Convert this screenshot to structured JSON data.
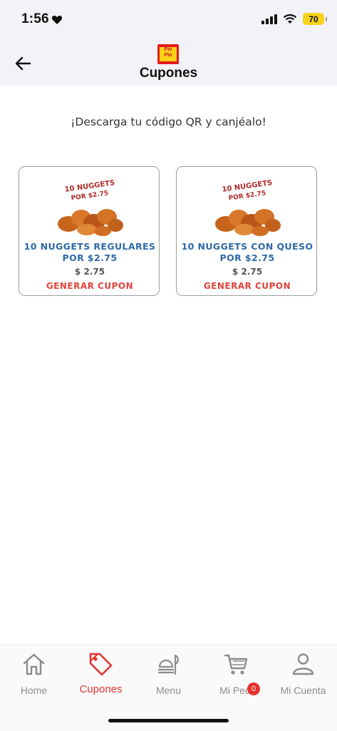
{
  "status_bar": {
    "time": "1:56",
    "battery": "70"
  },
  "header": {
    "title": "Cupones",
    "logo_text_1": "Pio",
    "logo_text_2": "Pio"
  },
  "subtitle": "¡Descarga tu código QR y canjéalo!",
  "coupons": [
    {
      "img_line1": "10 NUGGETS",
      "img_line2": "POR $2.75",
      "name": "10 NUGGETS REGULARES POR $2.75",
      "price": "$ 2.75",
      "action": "GENERAR CUPON"
    },
    {
      "img_line1": "10 NUGGETS",
      "img_line2": "POR $2.75",
      "name": "10 NUGGETS CON QUESO POR $2.75",
      "price": "$ 2.75",
      "action": "GENERAR CUPON"
    }
  ],
  "tabs": [
    {
      "label": "Home",
      "icon": "home-icon"
    },
    {
      "label": "Cupones",
      "icon": "coupon-tag-icon"
    },
    {
      "label": "Menu",
      "icon": "food-tray-icon"
    },
    {
      "label": "Mi Pedi",
      "icon": "cart-icon",
      "badge": "0"
    },
    {
      "label": "Mi Cuenta",
      "icon": "user-icon"
    }
  ],
  "colors": {
    "accent_red": "#e3342f",
    "coupon_blue": "#2d6aa6",
    "status_yellow": "#f6d21b"
  }
}
